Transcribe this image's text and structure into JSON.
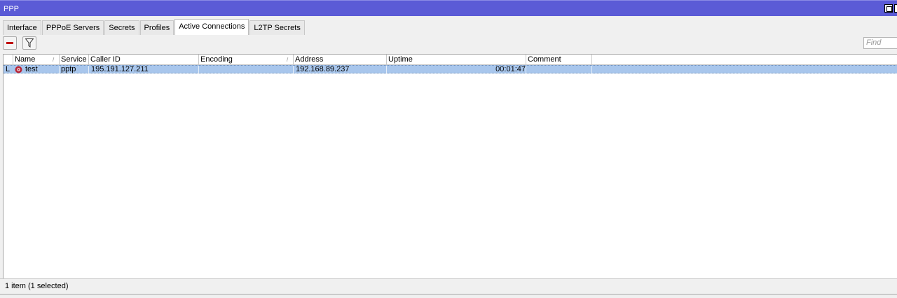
{
  "window": {
    "title": "PPP"
  },
  "tabs": [
    {
      "label": "Interface"
    },
    {
      "label": "PPPoE Servers"
    },
    {
      "label": "Secrets"
    },
    {
      "label": "Profiles"
    },
    {
      "label": "Active Connections",
      "active": true
    },
    {
      "label": "L2TP Secrets"
    }
  ],
  "toolbar": {
    "remove_icon": "minus-icon",
    "filter_icon": "filter-icon",
    "find_placeholder": "Find"
  },
  "table": {
    "columns": [
      "Name",
      "Service",
      "Caller ID",
      "Encoding",
      "Address",
      "Uptime",
      "Comment"
    ],
    "rows": [
      {
        "flag": "L",
        "icon": "connection-icon",
        "name": "test",
        "service": "pptp",
        "caller_id": "195.191.127.211",
        "encoding": "",
        "address": "192.168.89.237",
        "uptime": "00:01:47",
        "comment": ""
      }
    ],
    "selected_row_color": "#a8c6ec"
  },
  "status": {
    "text": "1 item (1 selected)"
  },
  "colors": {
    "titlebar": "#5b5bd6"
  }
}
